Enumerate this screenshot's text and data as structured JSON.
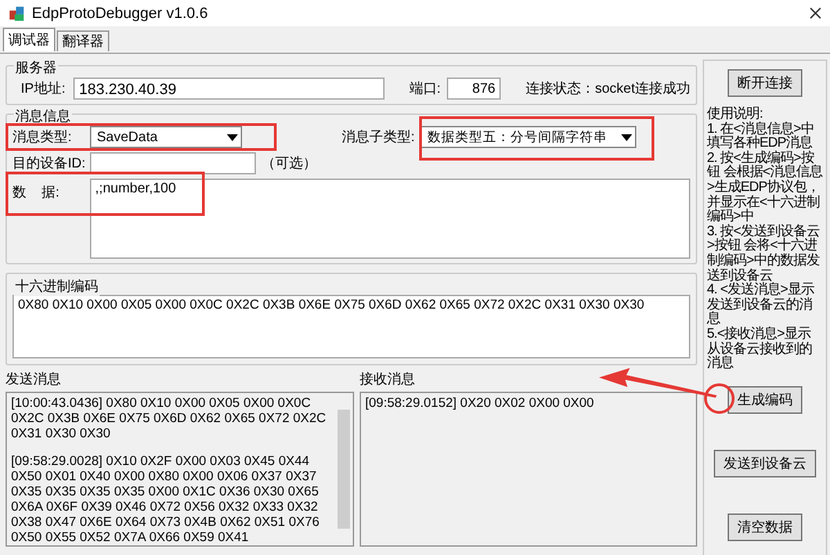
{
  "window": {
    "title": "EdpProtoDebugger v1.0.6"
  },
  "tabs": [
    {
      "label": "调试器",
      "selected": true
    },
    {
      "label": "翻译器",
      "selected": false
    }
  ],
  "server": {
    "title": "服务器",
    "ip_label": "IP地址:",
    "ip": "183.230.40.39",
    "port_label": "端口:",
    "port": "876",
    "status": "连接状态：socket连接成功"
  },
  "message": {
    "title": "消息信息",
    "type_label": "消息类型:",
    "type_value": "SaveData",
    "subtype_label": "消息子类型:",
    "subtype_value": "数据类型五：分号间隔字符串",
    "device_label": "目的设备ID:",
    "device_hint": "（可选）",
    "data_label": "数    据:",
    "data_value": ",;number,100"
  },
  "hex": {
    "title": "十六进制编码",
    "value": "0X80 0X10 0X00 0X05 0X00 0X0C 0X2C 0X3B 0X6E 0X75 0X6D 0X62 0X65 0X72 0X2C 0X31 0X30 0X30"
  },
  "sent": {
    "title": "发送消息",
    "entries": [
      "[10:00:43.0436] 0X80 0X10 0X00 0X05 0X00 0X0C 0X2C 0X3B 0X6E 0X75 0X6D 0X62 0X65 0X72 0X2C 0X31 0X30 0X30",
      "[09:58:29.0028] 0X10 0X2F 0X00 0X03 0X45 0X44 0X50 0X01 0X40 0X00 0X80 0X00 0X06 0X37 0X37 0X35 0X35 0X35 0X35 0X00 0X1C 0X36 0X30 0X65 0X6A 0X6F 0X39 0X46 0X72 0X56 0X32 0X33 0X32 0X38 0X47 0X6E 0X64 0X73 0X4B 0X62 0X51 0X76 0X50 0X55 0X52 0X7A 0X66 0X59 0X41"
    ]
  },
  "received": {
    "title": "接收消息",
    "entries": [
      "[09:58:29.0152] 0X20 0X02 0X00 0X00"
    ]
  },
  "side": {
    "disconnect": "断开连接",
    "help": [
      "使用说明:",
      "1. 在<消息信息>中填写各种EDP消息",
      "2. 按<生成编码>按钮 会根据<消息信息>生成EDP协议包，并显示在<十六进制编码>中",
      "3. 按<发送到设备云>按钮 会将<十六进制编码>中的数据发送到设备云",
      "4. <发送消息>显示发送到设备云的消息",
      "5.<接收消息>显示从设备云接收到的消息"
    ],
    "buttons": [
      "生成编码",
      "发送到设备云",
      "清空数据"
    ]
  }
}
